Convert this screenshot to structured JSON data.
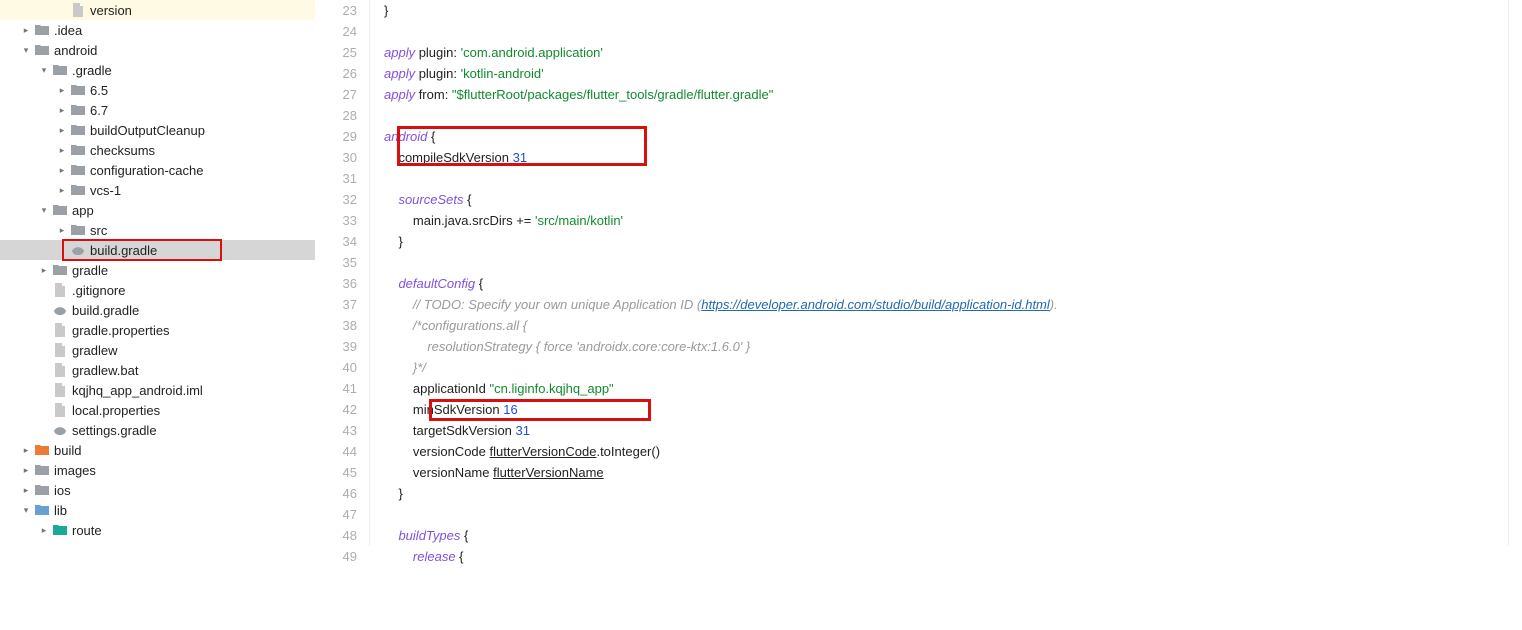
{
  "tree": {
    "items": [
      {
        "indent": 3,
        "chev": "",
        "icon": "file",
        "cls": "file-gray",
        "label": "version",
        "hl": "hl-yellow"
      },
      {
        "indent": 1,
        "chev": "▸",
        "icon": "folder",
        "cls": "folder-gray",
        "label": ".idea",
        "hl": ""
      },
      {
        "indent": 1,
        "chev": "▾",
        "icon": "folder",
        "cls": "folder-gray",
        "label": "android",
        "hl": ""
      },
      {
        "indent": 2,
        "chev": "▾",
        "icon": "folder",
        "cls": "folder-gray",
        "label": ".gradle",
        "hl": ""
      },
      {
        "indent": 3,
        "chev": "▸",
        "icon": "folder",
        "cls": "folder-gray",
        "label": "6.5",
        "hl": ""
      },
      {
        "indent": 3,
        "chev": "▸",
        "icon": "folder",
        "cls": "folder-gray",
        "label": "6.7",
        "hl": ""
      },
      {
        "indent": 3,
        "chev": "▸",
        "icon": "folder",
        "cls": "folder-gray",
        "label": "buildOutputCleanup",
        "hl": ""
      },
      {
        "indent": 3,
        "chev": "▸",
        "icon": "folder",
        "cls": "folder-gray",
        "label": "checksums",
        "hl": ""
      },
      {
        "indent": 3,
        "chev": "▸",
        "icon": "folder",
        "cls": "folder-gray",
        "label": "configuration-cache",
        "hl": ""
      },
      {
        "indent": 3,
        "chev": "▸",
        "icon": "folder",
        "cls": "folder-gray",
        "label": "vcs-1",
        "hl": ""
      },
      {
        "indent": 2,
        "chev": "▾",
        "icon": "folder",
        "cls": "folder-gray",
        "label": "app",
        "hl": ""
      },
      {
        "indent": 3,
        "chev": "▸",
        "icon": "folder",
        "cls": "folder-gray",
        "label": "src",
        "hl": ""
      },
      {
        "indent": 3,
        "chev": "",
        "icon": "gradle",
        "cls": "gradle-icon",
        "label": "build.gradle",
        "hl": "hl-gray"
      },
      {
        "indent": 2,
        "chev": "▸",
        "icon": "folder",
        "cls": "folder-gray",
        "label": "gradle",
        "hl": ""
      },
      {
        "indent": 2,
        "chev": "",
        "icon": "file",
        "cls": "file-gray",
        "label": ".gitignore",
        "hl": ""
      },
      {
        "indent": 2,
        "chev": "",
        "icon": "gradle",
        "cls": "gradle-icon",
        "label": "build.gradle",
        "hl": ""
      },
      {
        "indent": 2,
        "chev": "",
        "icon": "file",
        "cls": "file-gray",
        "label": "gradle.properties",
        "hl": ""
      },
      {
        "indent": 2,
        "chev": "",
        "icon": "file",
        "cls": "file-gray",
        "label": "gradlew",
        "hl": ""
      },
      {
        "indent": 2,
        "chev": "",
        "icon": "file",
        "cls": "file-gray",
        "label": "gradlew.bat",
        "hl": ""
      },
      {
        "indent": 2,
        "chev": "",
        "icon": "file",
        "cls": "file-gray",
        "label": "kqjhq_app_android.iml",
        "hl": ""
      },
      {
        "indent": 2,
        "chev": "",
        "icon": "file",
        "cls": "file-gray",
        "label": "local.properties",
        "hl": ""
      },
      {
        "indent": 2,
        "chev": "",
        "icon": "gradle",
        "cls": "gradle-icon",
        "label": "settings.gradle",
        "hl": ""
      },
      {
        "indent": 1,
        "chev": "▸",
        "icon": "folder",
        "cls": "folder-orange",
        "label": "build",
        "hl": ""
      },
      {
        "indent": 1,
        "chev": "▸",
        "icon": "folder",
        "cls": "folder-gray",
        "label": "images",
        "hl": ""
      },
      {
        "indent": 1,
        "chev": "▸",
        "icon": "folder",
        "cls": "folder-gray",
        "label": "ios",
        "hl": ""
      },
      {
        "indent": 1,
        "chev": "▾",
        "icon": "folder",
        "cls": "folder-blue",
        "label": "lib",
        "hl": ""
      },
      {
        "indent": 2,
        "chev": "▸",
        "icon": "folder",
        "cls": "folder-teal",
        "label": "route",
        "hl": ""
      }
    ]
  },
  "editor": {
    "first_line": 23,
    "lines": [
      {
        "n": 23,
        "html": "}"
      },
      {
        "n": 24,
        "html": ""
      },
      {
        "n": 25,
        "html": "<span class=\"mthd\">apply</span> plugin: <span class=\"str\">'com.android.application'</span>"
      },
      {
        "n": 26,
        "html": "<span class=\"mthd\">apply</span> plugin: <span class=\"str\">'kotlin-android'</span>"
      },
      {
        "n": 27,
        "html": "<span class=\"mthd\">apply</span> from: <span class=\"str\">\"$flutterRoot/packages/flutter_tools/gradle/flutter.gradle\"</span>"
      },
      {
        "n": 28,
        "html": ""
      },
      {
        "n": 29,
        "html": "<span class=\"mthd\">android</span> <span class=\"kw\">{</span>"
      },
      {
        "n": 30,
        "html": "    compileSdkVersion <span class=\"num\">31</span>"
      },
      {
        "n": 31,
        "html": ""
      },
      {
        "n": 32,
        "html": "    <span class=\"mthd\">sourceSets</span> <span class=\"kw\">{</span>"
      },
      {
        "n": 33,
        "html": "        main.java.srcDirs += <span class=\"str\">'src/main/kotlin'</span>"
      },
      {
        "n": 34,
        "html": "    <span class=\"kw\">}</span>"
      },
      {
        "n": 35,
        "html": ""
      },
      {
        "n": 36,
        "html": "    <span class=\"mthd\">defaultConfig</span> <span class=\"kw\">{</span>"
      },
      {
        "n": 37,
        "html": "        <span class=\"cmt\">// TODO: Specify your own unique Application ID (</span><span class=\"link\">https://developer.android.com/studio/build/application-id.html</span><span class=\"cmt\">).</span>"
      },
      {
        "n": 38,
        "html": "        <span class=\"cmt\">/*configurations.all {</span>"
      },
      {
        "n": 39,
        "html": "            <span class=\"cmt\">resolutionStrategy { force 'androidx.core:core-ktx:1.6.0' }</span>"
      },
      {
        "n": 40,
        "html": "        <span class=\"cmt\">}*/</span>"
      },
      {
        "n": 41,
        "html": "        applicationId <span class=\"str\">\"cn.liginfo.kqjhq_app\"</span>"
      },
      {
        "n": 42,
        "html": "        minSdkVersion <span class=\"num\">16</span>"
      },
      {
        "n": 43,
        "html": "        targetSdkVersion <span class=\"num\">31</span>"
      },
      {
        "n": 44,
        "html": "        versionCode <span class=\"underline\">flutterVersionCode</span>.toInteger()"
      },
      {
        "n": 45,
        "html": "        versionName <span class=\"underline\">flutterVersionName</span>"
      },
      {
        "n": 46,
        "html": "    <span class=\"kw\">}</span>"
      },
      {
        "n": 47,
        "html": ""
      },
      {
        "n": 48,
        "html": "    <span class=\"mthd\">buildTypes</span> <span class=\"kw\">{</span>"
      },
      {
        "n": 49,
        "html": "        <span class=\"mthd\">release</span> <span class=\"kw\">{</span>"
      }
    ]
  }
}
